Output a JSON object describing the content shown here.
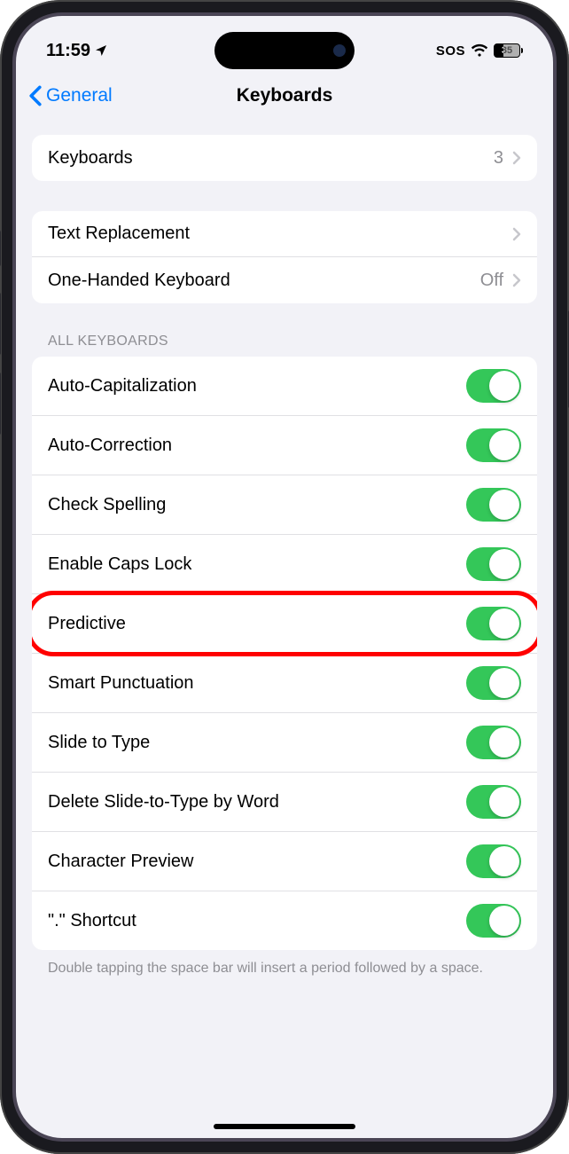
{
  "status": {
    "time": "11:59",
    "sos": "SOS",
    "battery": "35"
  },
  "nav": {
    "back": "General",
    "title": "Keyboards"
  },
  "group1": {
    "keyboards_label": "Keyboards",
    "keyboards_count": "3"
  },
  "group2": {
    "text_replacement": "Text Replacement",
    "one_handed": "One-Handed Keyboard",
    "one_handed_value": "Off"
  },
  "section_header": "ALL KEYBOARDS",
  "toggles": {
    "auto_cap": "Auto-Capitalization",
    "auto_correct": "Auto-Correction",
    "check_spelling": "Check Spelling",
    "caps_lock": "Enable Caps Lock",
    "predictive": "Predictive",
    "smart_punct": "Smart Punctuation",
    "slide_type": "Slide to Type",
    "delete_slide": "Delete Slide-to-Type by Word",
    "char_preview": "Character Preview",
    "shortcut": "\".\" Shortcut"
  },
  "footer": "Double tapping the space bar will insert a period followed by a space.",
  "highlighted_row": "predictive"
}
